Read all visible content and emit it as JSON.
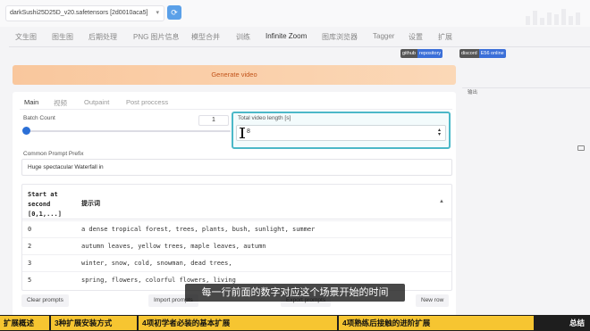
{
  "header": {
    "model_value": "darkSushi25D25D_v20.safetensors [2d0010aca5]",
    "refresh_icon": "refresh-icon"
  },
  "main_tabs": [
    "文生图",
    "图生图",
    "后期处理",
    "PNG 图片信息",
    "模型合并",
    "训练",
    "Infinite Zoom",
    "图库浏览器",
    "Tagger",
    "设置",
    "扩展"
  ],
  "active_tab": "Infinite Zoom",
  "badges": [
    {
      "left": "github",
      "right": "repository",
      "color": "#3b6fd8"
    },
    {
      "left": "discord",
      "right": "E56 online",
      "color": "#3b6fd8"
    }
  ],
  "generate_label": "Generate video",
  "sub_tabs": [
    "Main",
    "视频",
    "Outpaint",
    "Post proccess"
  ],
  "active_sub_tab": "Main",
  "batch": {
    "label": "Batch Count",
    "value": "1",
    "fraction": 0.01
  },
  "video_length": {
    "label": "Total video length [s]",
    "value": "8"
  },
  "prefix": {
    "label": "Common Prompt Prefix",
    "value": "Huge spectacular Waterfall in "
  },
  "table": {
    "header_start": "Start at\nsecond\n[0,1,...]",
    "header_prompt": "提示词",
    "rows": [
      {
        "sec": "0",
        "prompt": "a dense tropical forest, trees, plants, bush, sunlight, summer"
      },
      {
        "sec": "2",
        "prompt": "autumn leaves, yellow trees, maple leaves, autumn"
      },
      {
        "sec": "3",
        "prompt": "winter, snow, cold, snowman, dead trees,"
      },
      {
        "sec": "5",
        "prompt": "spring, flowers, colorful flowers, living"
      }
    ]
  },
  "buttons": {
    "clear": "Clear prompts",
    "import": "Import prompts",
    "export": "Export prompts",
    "new_row": "New row"
  },
  "subtitle": "每一行前面的数字对应这个场景开始的时间",
  "right_panel": {
    "label": "输出"
  },
  "chapters": [
    {
      "label": "扩展概述",
      "dark": false
    },
    {
      "label": "3种扩展安装方式",
      "dark": false
    },
    {
      "label": "4项初学者必装的基本扩展",
      "dark": false
    },
    {
      "label": "4项熟练后接触的进阶扩展",
      "dark": false
    },
    {
      "label": "总结",
      "dark": true
    }
  ]
}
